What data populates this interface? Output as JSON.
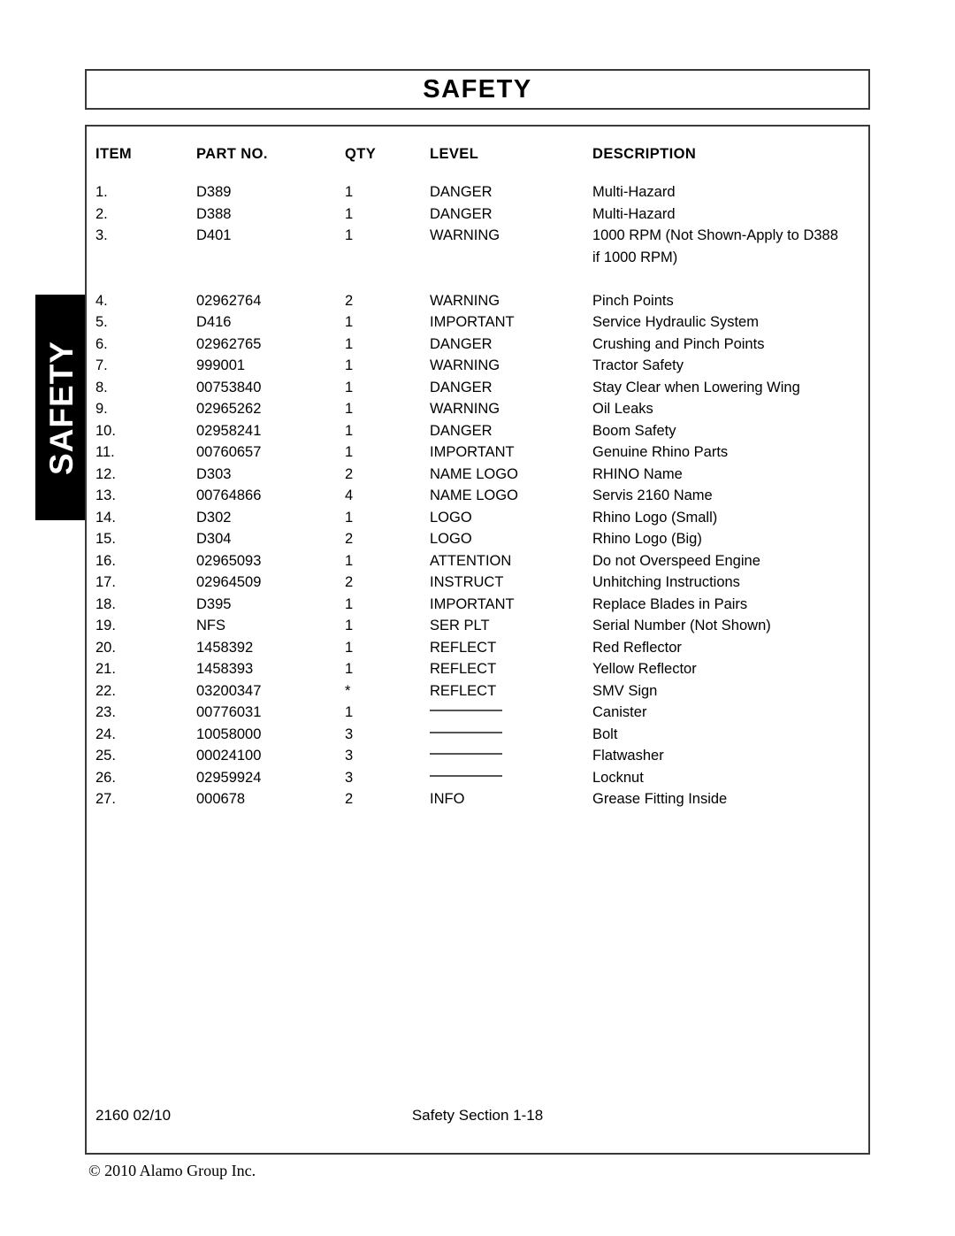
{
  "side_tab": {
    "label": "SAFETY"
  },
  "header": {
    "title": "SAFETY"
  },
  "table": {
    "columns": [
      "ITEM",
      "PART NO.",
      "QTY",
      "LEVEL",
      "DESCRIPTION"
    ],
    "rows": [
      {
        "item": "1.",
        "part": "D389",
        "qty": "1",
        "level": "DANGER",
        "desc": "Multi-Hazard"
      },
      {
        "item": "2.",
        "part": "D388",
        "qty": "1",
        "level": "DANGER",
        "desc": "Multi-Hazard"
      },
      {
        "item": "3.",
        "part": "D401",
        "qty": "1",
        "level": "WARNING",
        "desc": "1000 RPM (Not Shown-Apply to D388",
        "desc2": "if 1000 RPM)"
      },
      {
        "item": "4.",
        "part": "02962764",
        "qty": "2",
        "level": "WARNING",
        "desc": "Pinch Points"
      },
      {
        "item": "5.",
        "part": "D416",
        "qty": "1",
        "level": "IMPORTANT",
        "desc": "Service Hydraulic System"
      },
      {
        "item": "6.",
        "part": "02962765",
        "qty": "1",
        "level": "DANGER",
        "desc": "Crushing and Pinch Points"
      },
      {
        "item": "7.",
        "part": "999001",
        "qty": "1",
        "level": "WARNING",
        "desc": "Tractor Safety"
      },
      {
        "item": "8.",
        "part": "00753840",
        "qty": "1",
        "level": "DANGER",
        "desc": "Stay Clear when Lowering Wing"
      },
      {
        "item": "9.",
        "part": "02965262",
        "qty": "1",
        "level": "WARNING",
        "desc": "Oil Leaks"
      },
      {
        "item": "10.",
        "part": "02958241",
        "qty": "1",
        "level": "DANGER",
        "desc": "Boom Safety"
      },
      {
        "item": "11.",
        "part": "00760657",
        "qty": "1",
        "level": "IMPORTANT",
        "desc": "Genuine Rhino Parts"
      },
      {
        "item": "12.",
        "part": "D303",
        "qty": "2",
        "level": "NAME LOGO",
        "desc": "RHINO Name"
      },
      {
        "item": "13.",
        "part": "00764866",
        "qty": "4",
        "level": "NAME LOGO",
        "desc": "Servis 2160 Name"
      },
      {
        "item": "14.",
        "part": "D302",
        "qty": "1",
        "level": "LOGO",
        "desc": "Rhino Logo (Small)"
      },
      {
        "item": "15.",
        "part": "D304",
        "qty": "2",
        "level": "LOGO",
        "desc": "Rhino Logo (Big)"
      },
      {
        "item": "16.",
        "part": "02965093",
        "qty": "1",
        "level": "ATTENTION",
        "desc": "Do not Overspeed Engine"
      },
      {
        "item": "17.",
        "part": "02964509",
        "qty": "2",
        "level": "INSTRUCT",
        "desc": "Unhitching Instructions"
      },
      {
        "item": "18.",
        "part": "D395",
        "qty": "1",
        "level": "IMPORTANT",
        "desc": "Replace Blades in Pairs"
      },
      {
        "item": "19.",
        "part": "NFS",
        "qty": "1",
        "level": "SER PLT",
        "desc": "Serial Number (Not Shown)"
      },
      {
        "item": "20.",
        "part": "1458392",
        "qty": "1",
        "level": "REFLECT",
        "desc": "Red Reflector"
      },
      {
        "item": "21.",
        "part": "1458393",
        "qty": "1",
        "level": "REFLECT",
        "desc": "Yellow Reflector"
      },
      {
        "item": "22.",
        "part": "03200347",
        "qty": "*",
        "level": "REFLECT",
        "desc": "SMV Sign"
      },
      {
        "item": "23.",
        "part": "00776031",
        "qty": "1",
        "level": "",
        "desc": "Canister"
      },
      {
        "item": "24.",
        "part": "10058000",
        "qty": "3",
        "level": "",
        "desc": "Bolt"
      },
      {
        "item": "25.",
        "part": "00024100",
        "qty": "3",
        "level": "",
        "desc": "Flatwasher"
      },
      {
        "item": "26.",
        "part": "02959924",
        "qty": "3",
        "level": "",
        "desc": "Locknut"
      },
      {
        "item": "27.",
        "part": "000678",
        "qty": "2",
        "level": "INFO",
        "desc": "Grease Fitting Inside"
      }
    ]
  },
  "footer": {
    "model_date": "2160   02/10",
    "section": "Safety Section 1-18",
    "copyright": "© 2010 Alamo Group Inc."
  }
}
